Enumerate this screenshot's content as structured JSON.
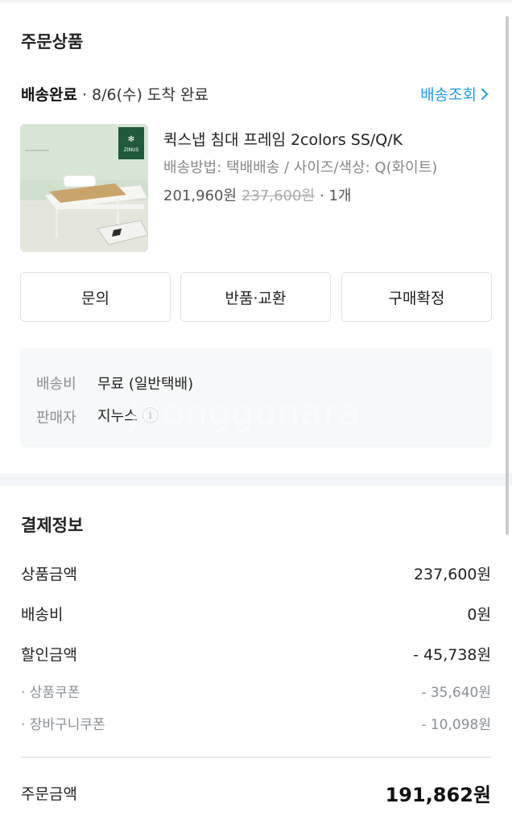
{
  "order_section": {
    "title": "주문상품",
    "status": "배송완료",
    "status_detail": " · 8/6(수) 도착 완료",
    "track_link": "배송조회"
  },
  "product": {
    "name": "퀵스냅 침대 프레임 2colors SS/Q/K",
    "option": "배송방법: 택배배송 / 사이즈/색상: Q(화이트)",
    "price": "201,960원",
    "original_price": "237,600원",
    "quantity": "· 1개",
    "thumb_logo": "ZINUS"
  },
  "actions": {
    "inquiry": "문의",
    "return_exchange": "반품·교환",
    "confirm_purchase": "구매확정"
  },
  "info": {
    "shipping_label": "배송비",
    "shipping_value": "무료 (일반택배)",
    "seller_label": "판매자",
    "seller_value": "지누스",
    "info_icon_glyph": "i"
  },
  "watermark": "Joonggonara",
  "payment": {
    "title": "결제정보",
    "rows": [
      {
        "label": "상품금액",
        "value": "237,600원"
      },
      {
        "label": "배송비",
        "value": "0원"
      },
      {
        "label": "할인금액",
        "value": "- 45,738원"
      }
    ],
    "sub_rows": [
      {
        "label": "· 상품쿠폰",
        "value": "- 35,640원"
      },
      {
        "label": "· 장바구니쿠폰",
        "value": "- 10,098원"
      }
    ],
    "total_label": "주문금액",
    "total_value": "191,862원"
  },
  "colors": {
    "accent_link": "#1d9bf0",
    "info_bg": "#f6f8f9",
    "muted_text": "#8a8f94"
  }
}
